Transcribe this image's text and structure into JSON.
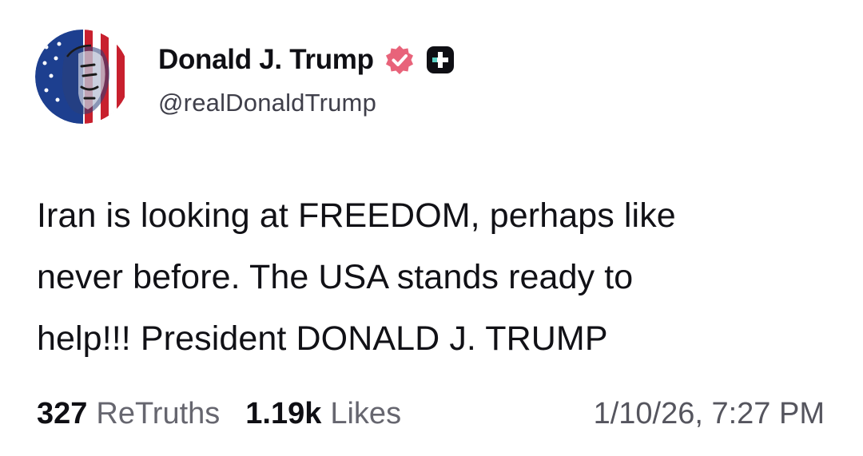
{
  "post": {
    "author": {
      "display_name": "Donald J. Trump",
      "handle": "@realDonaldTrump",
      "avatar_icon": "flag-portrait-avatar",
      "verified_icon": "verified-badge-icon",
      "plus_icon": "truth-plus-icon"
    },
    "text_lines": [
      "Iran is looking at FREEDOM, perhaps like",
      "never before. The USA stands ready to",
      "help!!! President DONALD J. TRUMP"
    ],
    "stats": {
      "retruths_count": "327",
      "retruths_label": "ReTruths",
      "likes_count": "1.19k",
      "likes_label": "Likes"
    },
    "timestamp": "1/10/26, 7:27 PM"
  },
  "colors": {
    "verified_badge": "#e8637a",
    "plus_badge": "#0f0f14",
    "plus_accent": "#5ad0c4",
    "text": "#0f0f14",
    "muted": "#66666f"
  }
}
